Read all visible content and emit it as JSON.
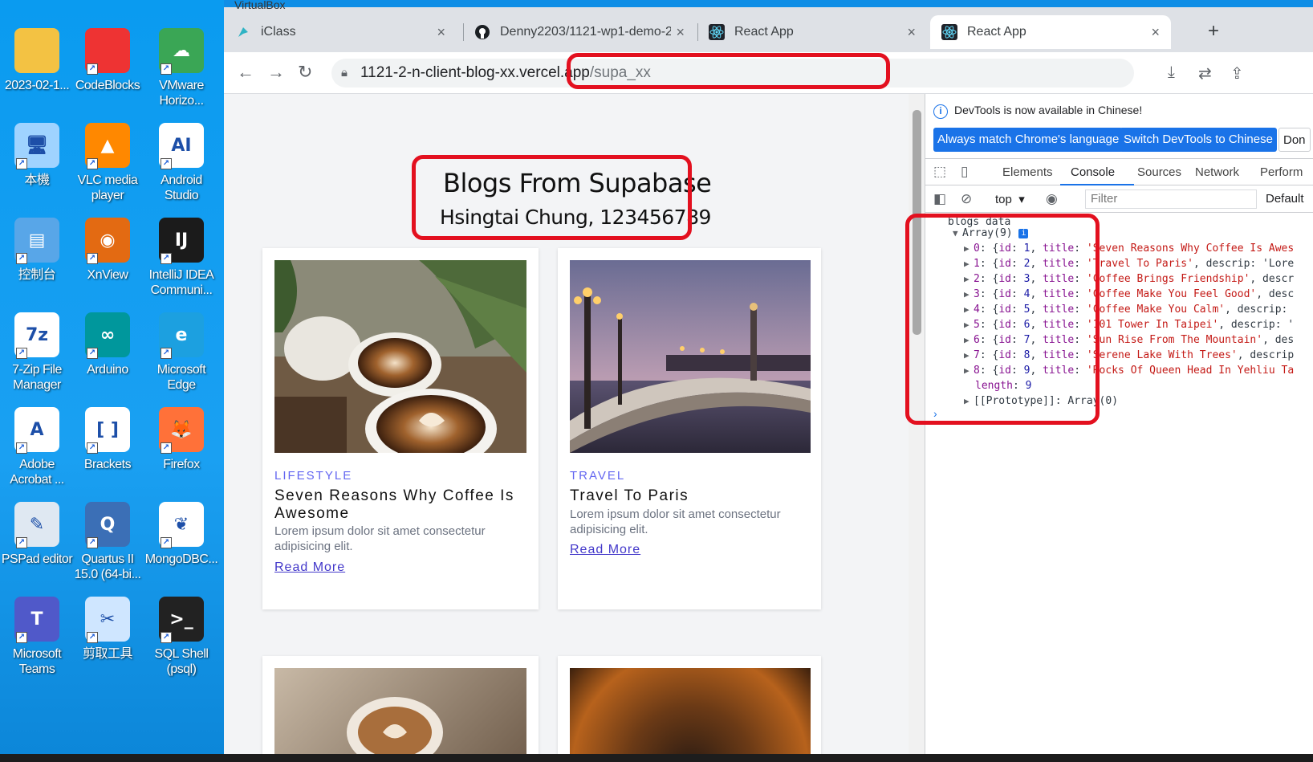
{
  "window": {
    "vm_title": "VirtualBox"
  },
  "desktop": {
    "icons": [
      {
        "label": "2023-02-1...",
        "glyph": "",
        "color": "#f3c243"
      },
      {
        "label": "CodeBlocks",
        "glyph": "",
        "color": "#e33"
      },
      {
        "label": "VMware Horizo...",
        "glyph": "☁",
        "color": "#3aa655"
      },
      {
        "label": "本機",
        "glyph": "🖥",
        "color": "#9fd3ff"
      },
      {
        "label": "VLC media player",
        "glyph": "▲",
        "color": "#ff8800"
      },
      {
        "label": "Android Studio",
        "glyph": "AI",
        "color": "#ffffff"
      },
      {
        "label": "控制台",
        "glyph": "▤",
        "color": "#58a6e8"
      },
      {
        "label": "XnView",
        "glyph": "◉",
        "color": "#e36a12"
      },
      {
        "label": "IntelliJ IDEA Communi...",
        "glyph": "IJ",
        "color": "#1b1b1b"
      },
      {
        "label": "7-Zip File Manager",
        "glyph": "7z",
        "color": "#ffffff"
      },
      {
        "label": "Arduino",
        "glyph": "∞",
        "color": "#00979c"
      },
      {
        "label": "Microsoft Edge",
        "glyph": "e",
        "color": "#1ca0e0"
      },
      {
        "label": "Adobe Acrobat ...",
        "glyph": "A",
        "color": "#ffffff"
      },
      {
        "label": "Brackets",
        "glyph": "[ ]",
        "color": "#ffffff"
      },
      {
        "label": "Firefox",
        "glyph": "🦊",
        "color": "#ff7139"
      },
      {
        "label": "PSPad editor",
        "glyph": "✎",
        "color": "#dfe8f2"
      },
      {
        "label": "Quartus II 15.0 (64-bi...",
        "glyph": "Q",
        "color": "#3b6fb6"
      },
      {
        "label": "MongoDBC...",
        "glyph": "❦",
        "color": "#ffffff"
      },
      {
        "label": "Microsoft Teams",
        "glyph": "T",
        "color": "#5059c9"
      },
      {
        "label": "剪取工具",
        "glyph": "✂",
        "color": "#cfe6ff"
      },
      {
        "label": "SQL Shell (psql)",
        "glyph": ">_",
        "color": "#222222"
      }
    ]
  },
  "browser": {
    "tabs": [
      {
        "title": "iClass",
        "close": "×"
      },
      {
        "title": "Denny2203/1121-wp1-demo-2",
        "close": "×"
      },
      {
        "title": "React App",
        "close": "×"
      },
      {
        "title": "React App",
        "close": "×"
      }
    ],
    "new_tab": "+",
    "url_host": "1121-2-n-client-blog-xx.vercel.app",
    "url_path": "/supa_xx"
  },
  "page": {
    "title": "Blogs From Supabase",
    "author": "Hsingtai Chung, 123456789",
    "cards": [
      {
        "category": "LIFESTYLE",
        "title": "Seven Reasons Why Coffee Is Awesome",
        "descrip": "Lorem ipsum dolor sit amet consectetur adipisicing elit.",
        "more": "Read More"
      },
      {
        "category": "TRAVEL",
        "title": "Travel To Paris",
        "descrip": "Lorem ipsum dolor sit amet consectetur adipisicing elit.",
        "more": "Read More"
      }
    ]
  },
  "devtools": {
    "info": "DevTools is now available in Chinese!",
    "btn_match": "Always match Chrome's language",
    "btn_switch": "Switch DevTools to Chinese",
    "btn_dont": "Don",
    "tabs": [
      "Elements",
      "Console",
      "Sources",
      "Network",
      "Perform"
    ],
    "context": "top",
    "filter_placeholder": "Filter",
    "levels": "Default",
    "log_label": "blogs data",
    "array_label": "Array(9)",
    "entries": [
      {
        "index": "0",
        "id": "1",
        "title": "'Seven Reasons Why Coffee Is Awes",
        "tail": ""
      },
      {
        "index": "1",
        "id": "2",
        "title": "'Travel To Paris'",
        "tail": ", descrip: 'Lore"
      },
      {
        "index": "2",
        "id": "3",
        "title": "'Coffee Brings Friendship'",
        "tail": ", descr"
      },
      {
        "index": "3",
        "id": "4",
        "title": "'Coffee Make You Feel Good'",
        "tail": ", desc"
      },
      {
        "index": "4",
        "id": "5",
        "title": "'Coffee Make You Calm'",
        "tail": ", descrip:"
      },
      {
        "index": "5",
        "id": "6",
        "title": "'101 Tower In Taipei'",
        "tail": ", descrip: '"
      },
      {
        "index": "6",
        "id": "7",
        "title": "'Sun Rise From The Mountain'",
        "tail": ", des"
      },
      {
        "index": "7",
        "id": "8",
        "title": "'Serene Lake With Trees'",
        "tail": ", descrip"
      },
      {
        "index": "8",
        "id": "9",
        "title": "'Rocks Of Queen Head In Yehliu Ta",
        "tail": ""
      }
    ],
    "length_label": "length",
    "length_value": "9",
    "prototype_label": "[[Prototype]]",
    "prototype_value": "Array(0)"
  }
}
